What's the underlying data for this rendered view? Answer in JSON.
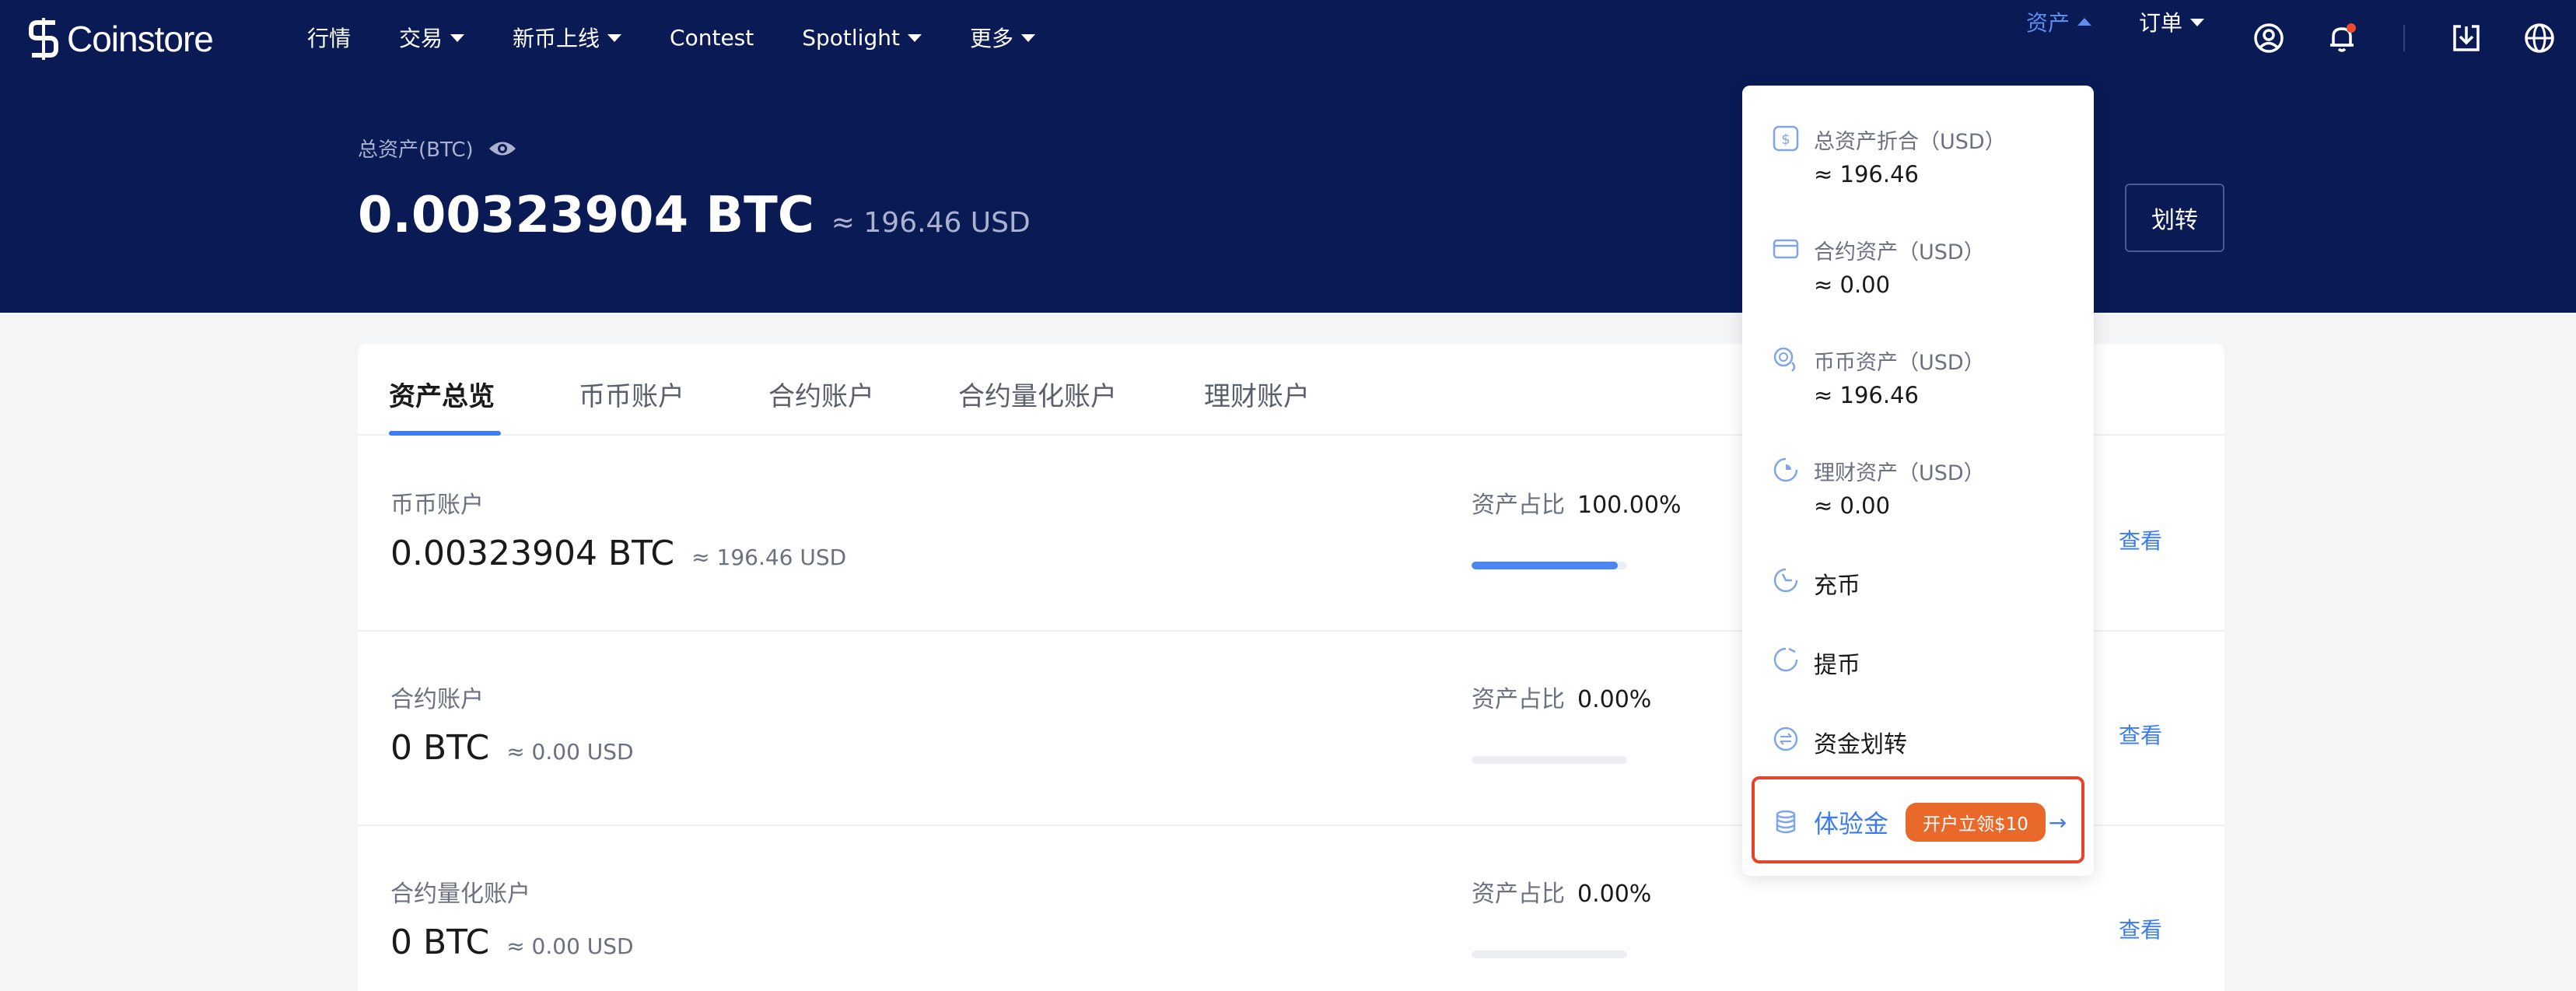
{
  "brand": {
    "name": "Coinstore"
  },
  "nav": {
    "links": [
      {
        "label": "行情",
        "caret": false
      },
      {
        "label": "交易",
        "caret": true
      },
      {
        "label": "新币上线",
        "caret": true
      },
      {
        "label": "Contest",
        "caret": false
      },
      {
        "label": "Spotlight",
        "caret": true
      },
      {
        "label": "更多",
        "caret": true
      }
    ],
    "assets_label": "资产",
    "orders_label": "订单",
    "icons": [
      "user-icon",
      "bell-icon",
      "download-icon",
      "globe-icon"
    ]
  },
  "header": {
    "total_label": "总资产(BTC)",
    "total_value": "0.00323904 BTC",
    "total_usd": "≈ 196.46 USD",
    "transfer_label": "划转"
  },
  "tabs": [
    {
      "label": "资产总览",
      "active": true
    },
    {
      "label": "币币账户",
      "active": false
    },
    {
      "label": "合约账户",
      "active": false
    },
    {
      "label": "合约量化账户",
      "active": false
    },
    {
      "label": "理财账户",
      "active": false
    }
  ],
  "accounts": [
    {
      "name": "币币账户",
      "value": "0.00323904 BTC",
      "usd": "≈ 196.46 USD",
      "ratio_label": "资产占比",
      "ratio": "100.00%",
      "ratio_fraction": 1.0,
      "view": "查看"
    },
    {
      "name": "合约账户",
      "value": "0 BTC",
      "usd": "≈ 0.00 USD",
      "ratio_label": "资产占比",
      "ratio": "0.00%",
      "ratio_fraction": 0.0,
      "view": "查看"
    },
    {
      "name": "合约量化账户",
      "value": "0 BTC",
      "usd": "≈ 0.00 USD",
      "ratio_label": "资产占比",
      "ratio": "0.00%",
      "ratio_fraction": 0.0,
      "view": "查看"
    }
  ],
  "dropdown": {
    "summary": [
      {
        "label": "总资产折合（USD）",
        "amount": "≈ 196.46",
        "icon": "dollar-icon"
      },
      {
        "label": "合约资产（USD）",
        "amount": "≈ 0.00",
        "icon": "card-icon"
      },
      {
        "label": "币币资产（USD）",
        "amount": "≈ 196.46",
        "icon": "coins-icon"
      },
      {
        "label": "理财资产（USD）",
        "amount": "≈ 0.00",
        "icon": "finance-icon"
      }
    ],
    "actions": [
      {
        "label": "充币",
        "icon": "deposit-icon"
      },
      {
        "label": "提币",
        "icon": "withdraw-icon"
      },
      {
        "label": "资金划转",
        "icon": "transfer-icon"
      }
    ],
    "trial": {
      "label": "体验金",
      "badge": "开户立领$10",
      "arrow": "→",
      "icon": "coin-stack-icon"
    }
  },
  "colors": {
    "header_bg": "#0a1a55",
    "accent": "#3b7cf2",
    "badge": "#e8692a",
    "highlight": "#e8442a"
  }
}
